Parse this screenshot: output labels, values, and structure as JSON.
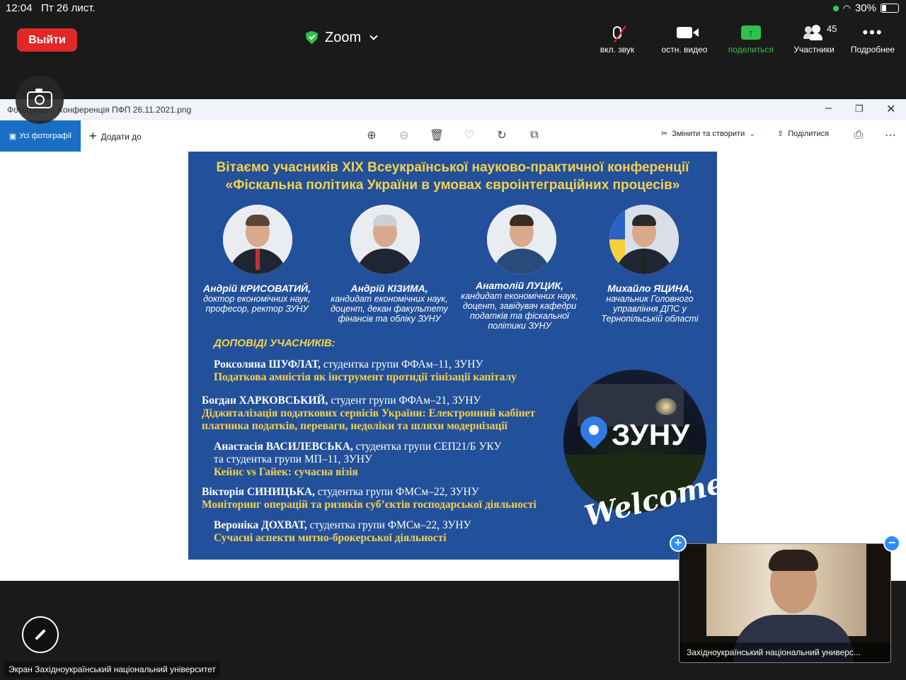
{
  "status": {
    "time": "12:04",
    "date": "Пт 26 лист.",
    "battery": "30%",
    "battery_level": 0.3
  },
  "zoom": {
    "leave_label": "Выйти",
    "title": "Zoom",
    "tools": {
      "mute": "вкл. звук",
      "video": "остн. видео",
      "share": "поделиться",
      "participants": "Участники",
      "more": "Подробнее"
    },
    "participant_count": "45",
    "share_color": "#2fc24a",
    "leave_color": "#e02828"
  },
  "viewer": {
    "window_title": "Фотографії - Конференція ПФП 26.11.2021.png",
    "all_photos": "Усі фотографії",
    "add_to": "Додати до",
    "edit_create": "Змінити та створити",
    "share": "Поділитися",
    "accent": "#1a6fc4"
  },
  "poster": {
    "title_line1": "Вітаємо учасників XIX Всеукраїнської науково-практичної конференції",
    "title_line2": "«Фіскальна політика України в умовах євроінтеграційних процесів»",
    "people": [
      {
        "name": "Андрій КРИСОВАТИЙ,",
        "role": "доктор економічних наук, професор, ректор ЗУНУ"
      },
      {
        "name": "Андрій КІЗИМА,",
        "role": "кандидат економічних наук, доцент, декан факультету фінансів та обліку ЗУНУ"
      },
      {
        "name": "Анатолій ЛУЦИК,",
        "role": "кандидат економічних наук, доцент, завідувач кафедри податків та фіскальної політики ЗУНУ"
      },
      {
        "name": "Михайло ЯЦИНА,",
        "role": "начальник Головного управління ДПС у Тернопільській області"
      }
    ],
    "section": "ДОПОВІДІ УЧАСНИКІВ:",
    "reports": [
      {
        "name": "Роксоляна ШУФЛАТ,",
        "info": " студентка групи ФФАм–11, ЗУНУ",
        "topic": "Податкова амністія як інструмент протидії тінізації капіталу"
      },
      {
        "name": "Богдан ХАРКОВСЬКИЙ,",
        "info": " студент групи ФФАм–21, ЗУНУ",
        "topic": "Діджиталізація податкових сервісів України: Електронний кабінет",
        "topic2": "платника податків, переваги, недоліки та шляхи модернізації"
      },
      {
        "name": "Анастасія ВАСИЛЕВСЬКА,",
        "info": " студентка групи СЕП21/Б УКУ",
        "info2": "та студентка групи МП–11, ЗУНУ",
        "topic": "Кейнс vs Гайек: сучасна візія"
      },
      {
        "name": "Вікторія СИНИЦЬКА,",
        "info": " студентка групи ФМСм–22, ЗУНУ",
        "topic": "Моніторинг операцій та ризиків суб’єктів господарської діяльності"
      },
      {
        "name": "Вероніка ДОХВАТ,",
        "info": " студентка групи ФМСм–22, ЗУНУ",
        "topic": "Сучасні аспекти митно-брокерської діяльності"
      }
    ],
    "logo_text": "ЗУНУ",
    "welcome": "Welcome",
    "accent": "#f6d24b",
    "background": "#23509a"
  },
  "bottom": {
    "screen_label": "Экран Західноукраїнський національний університет",
    "video_name": "Західноукраїнський національний универс..."
  }
}
